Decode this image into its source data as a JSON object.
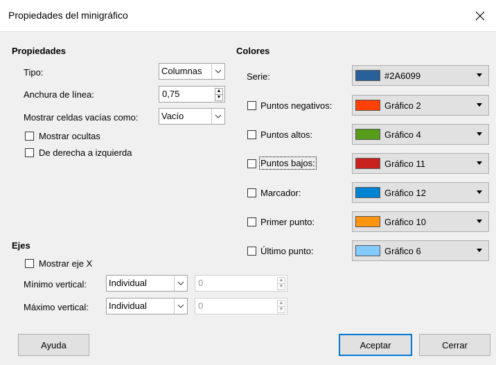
{
  "window": {
    "title": "Propiedades del minigráfico"
  },
  "properties": {
    "heading": "Propiedades",
    "type_label": "Tipo:",
    "type_value": "Columnas",
    "line_width_label": "Anchura de línea:",
    "line_width_value": "0,75",
    "empty_cells_label": "Mostrar celdas vacías como:",
    "empty_cells_value": "Vacío",
    "show_hidden_label": "Mostrar ocultas",
    "rtl_label": "De derecha a izquierda"
  },
  "axes": {
    "heading": "Ejes",
    "show_x_label": "Mostrar eje X",
    "min_label": "Mínimo vertical:",
    "min_mode": "Individual",
    "min_value": "0",
    "max_label": "Máximo vertical:",
    "max_mode": "Individual",
    "max_value": "0"
  },
  "colors": {
    "heading": "Colores",
    "series_label": "Serie:",
    "rows": [
      {
        "label": "Serie:",
        "value": "#2A6099",
        "color": "#2A6099",
        "checked": null
      },
      {
        "label": "Puntos negativos:",
        "value": "Gráfico 2",
        "color": "#FF4000",
        "checked": false
      },
      {
        "label": "Puntos altos:",
        "value": "Gráfico 4",
        "color": "#579D1C",
        "checked": false
      },
      {
        "label": "Puntos bajos:",
        "value": "Gráfico 11",
        "color": "#C9211E",
        "checked": false
      },
      {
        "label": "Marcador:",
        "value": "Gráfico 12",
        "color": "#0084D1",
        "checked": false
      },
      {
        "label": "Primer punto:",
        "value": "Gráfico 10",
        "color": "#FF950E",
        "checked": false
      },
      {
        "label": "Último punto:",
        "value": "Gráfico 6",
        "color": "#83CAFF",
        "checked": false
      }
    ]
  },
  "buttons": {
    "help": "Ayuda",
    "ok": "Aceptar",
    "close": "Cerrar"
  }
}
